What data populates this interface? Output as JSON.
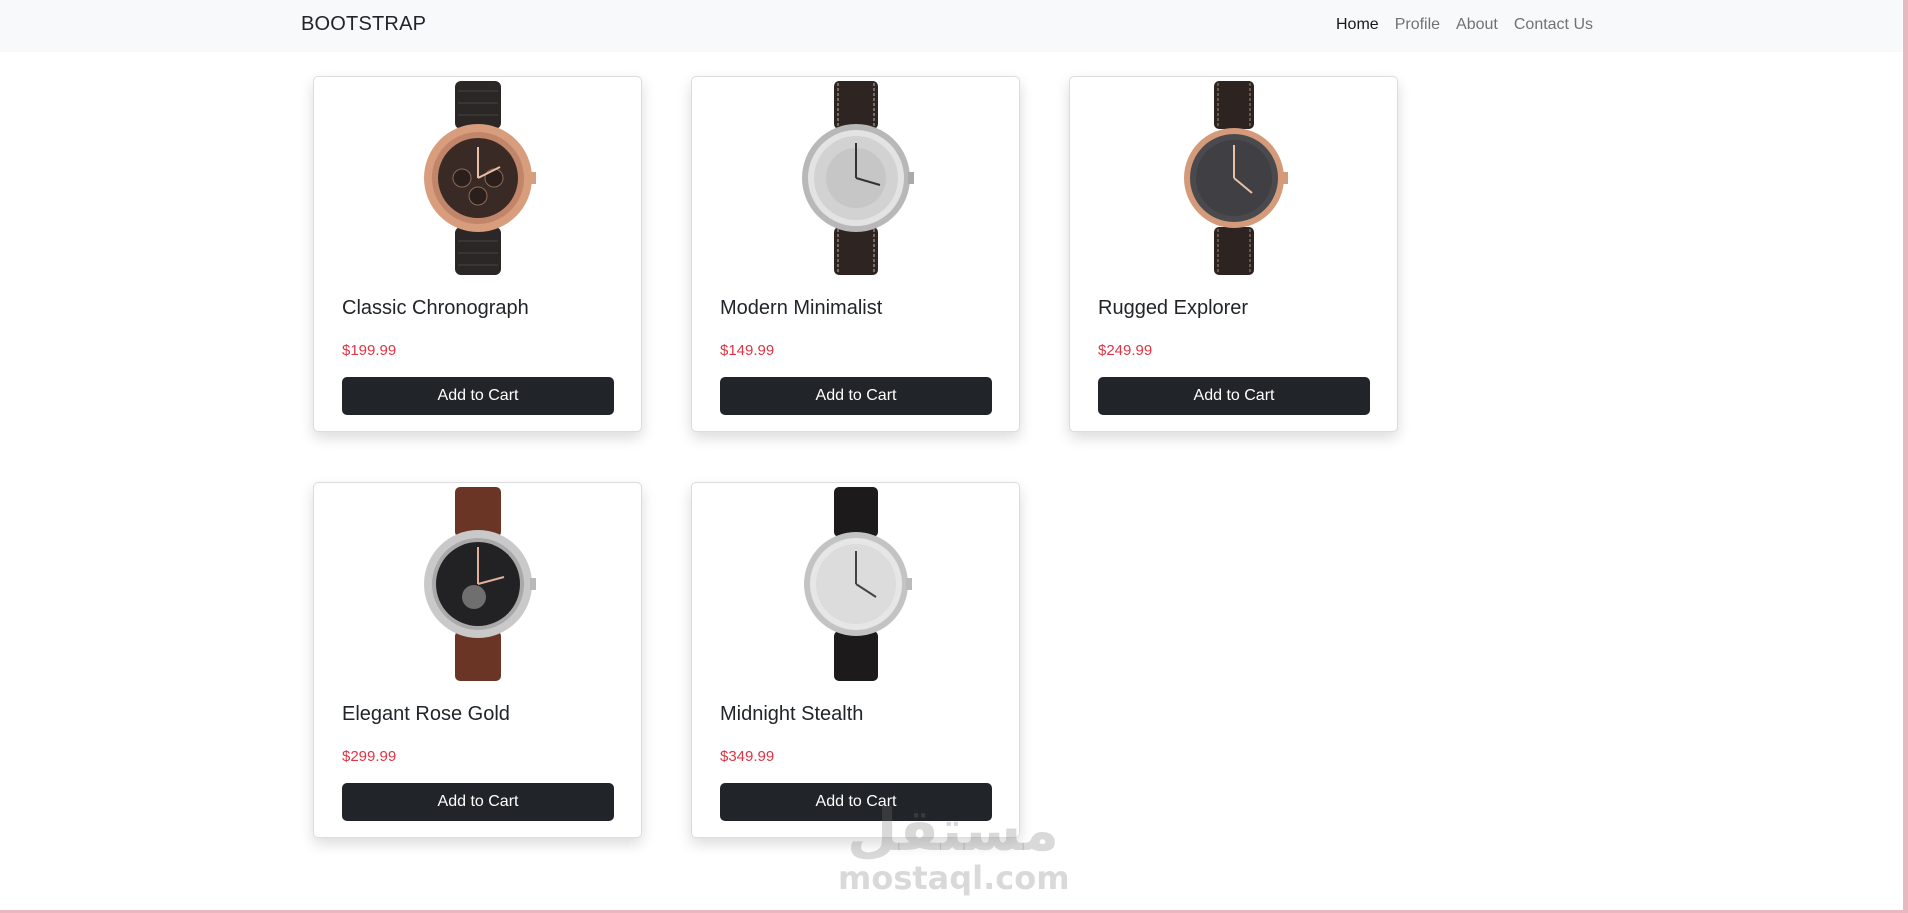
{
  "navbar": {
    "brand": "BOOTSTRAP",
    "links": [
      "Home",
      "Profile",
      "About",
      "Contact Us"
    ]
  },
  "products": [
    {
      "name": "Classic Chronograph",
      "price": "$199.99",
      "button": "Add to Cart"
    },
    {
      "name": "Modern Minimalist",
      "price": "$149.99",
      "button": "Add to Cart"
    },
    {
      "name": "Rugged Explorer",
      "price": "$249.99",
      "button": "Add to Cart"
    },
    {
      "name": "Elegant Rose Gold",
      "price": "$299.99",
      "button": "Add to Cart"
    },
    {
      "name": "Midnight Stealth",
      "price": "$349.99",
      "button": "Add to Cart"
    }
  ],
  "watermark": {
    "arabic": "مستقل",
    "latin": "mostaql.com"
  },
  "colors": {
    "price": "#dc3545",
    "button": "#212529",
    "navbar_bg": "#f8f9fa"
  }
}
